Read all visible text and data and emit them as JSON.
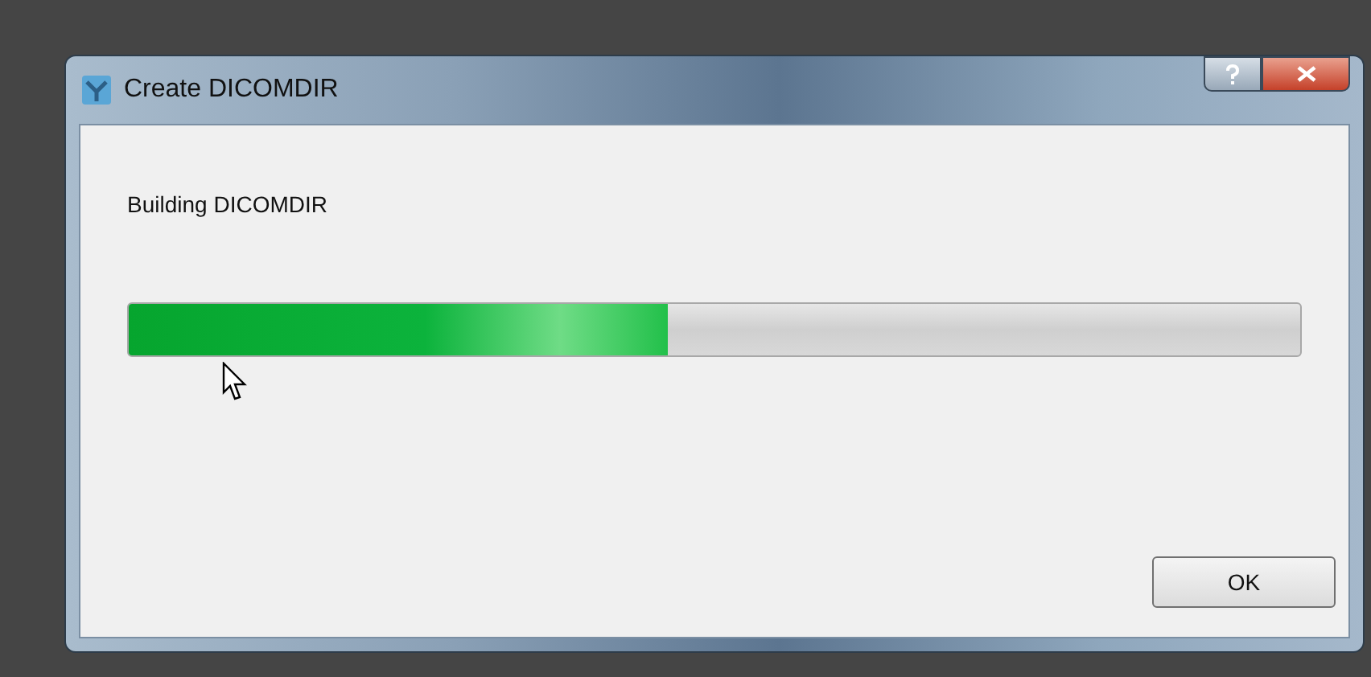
{
  "window": {
    "title": "Create DICOMDIR"
  },
  "message": "Building DICOMDIR",
  "progress": {
    "level": 0.46
  },
  "buttons": [
    {
      "label": "OK"
    }
  ]
}
